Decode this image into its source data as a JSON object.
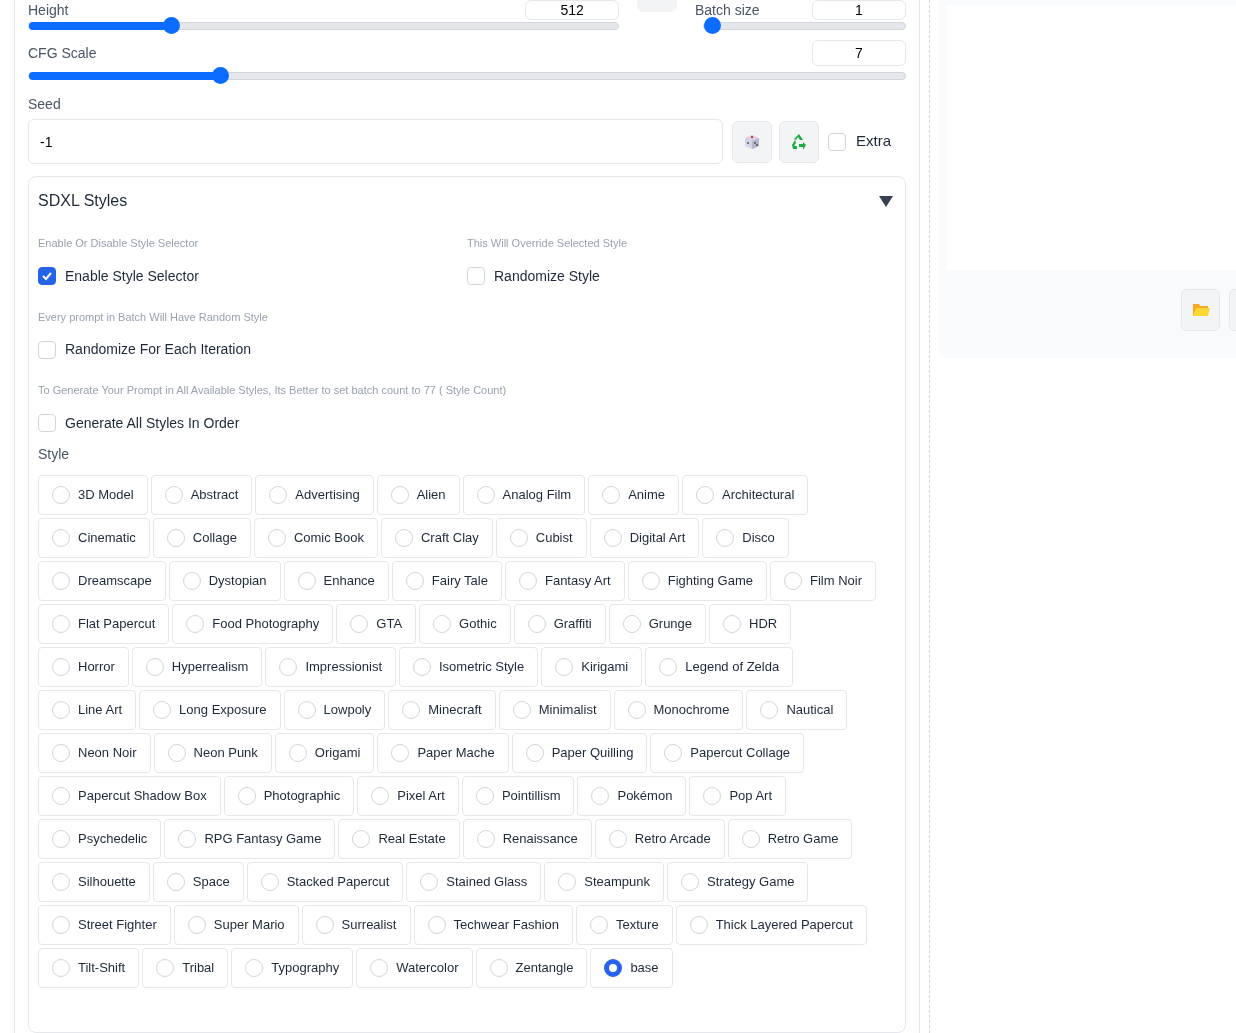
{
  "sliders": [
    {
      "label": "Height",
      "value": "512",
      "level": 0.234
    },
    {
      "label": "Batch size",
      "value": "1",
      "level": 0
    },
    {
      "label": "CFG Scale",
      "value": "7",
      "level": 0.213
    }
  ],
  "seed": {
    "label": "Seed",
    "value": "-1",
    "extra": {
      "label": "Extra",
      "checked": false
    }
  },
  "sdxl_styles": {
    "title": "SDXL Styles",
    "expanded": true,
    "options": [
      {
        "hint": "Enable Or Disable Style Selector",
        "label": "Enable Style Selector",
        "checked": true
      },
      {
        "hint": "This Will Override Selected Style",
        "label": "Randomize Style",
        "checked": false
      },
      {
        "hint": "Every prompt in Batch Will Have Random Style",
        "label": "Randomize For Each Iteration",
        "checked": false
      },
      {
        "hint": "To Generate Your Prompt in All Available Styles, Its Better to set batch count to 77 ( Style Count)",
        "label": "Generate All Styles In Order",
        "checked": false
      }
    ],
    "style_label": "Style",
    "styles": [
      {
        "label": "3D Model",
        "selected": false
      },
      {
        "label": "Abstract",
        "selected": false
      },
      {
        "label": "Advertising",
        "selected": false
      },
      {
        "label": "Alien",
        "selected": false
      },
      {
        "label": "Analog Film",
        "selected": false
      },
      {
        "label": "Anime",
        "selected": false
      },
      {
        "label": "Architectural",
        "selected": false
      },
      {
        "label": "Cinematic",
        "selected": false
      },
      {
        "label": "Collage",
        "selected": false
      },
      {
        "label": "Comic Book",
        "selected": false
      },
      {
        "label": "Craft Clay",
        "selected": false
      },
      {
        "label": "Cubist",
        "selected": false
      },
      {
        "label": "Digital Art",
        "selected": false
      },
      {
        "label": "Disco",
        "selected": false
      },
      {
        "label": "Dreamscape",
        "selected": false
      },
      {
        "label": "Dystopian",
        "selected": false
      },
      {
        "label": "Enhance",
        "selected": false
      },
      {
        "label": "Fairy Tale",
        "selected": false
      },
      {
        "label": "Fantasy Art",
        "selected": false
      },
      {
        "label": "Fighting Game",
        "selected": false
      },
      {
        "label": "Film Noir",
        "selected": false
      },
      {
        "label": "Flat Papercut",
        "selected": false
      },
      {
        "label": "Food Photography",
        "selected": false
      },
      {
        "label": "GTA",
        "selected": false
      },
      {
        "label": "Gothic",
        "selected": false
      },
      {
        "label": "Graffiti",
        "selected": false
      },
      {
        "label": "Grunge",
        "selected": false
      },
      {
        "label": "HDR",
        "selected": false
      },
      {
        "label": "Horror",
        "selected": false
      },
      {
        "label": "Hyperrealism",
        "selected": false
      },
      {
        "label": "Impressionist",
        "selected": false
      },
      {
        "label": "Isometric Style",
        "selected": false
      },
      {
        "label": "Kirigami",
        "selected": false
      },
      {
        "label": "Legend of Zelda",
        "selected": false
      },
      {
        "label": "Line Art",
        "selected": false
      },
      {
        "label": "Long Exposure",
        "selected": false
      },
      {
        "label": "Lowpoly",
        "selected": false
      },
      {
        "label": "Minecraft",
        "selected": false
      },
      {
        "label": "Minimalist",
        "selected": false
      },
      {
        "label": "Monochrome",
        "selected": false
      },
      {
        "label": "Nautical",
        "selected": false
      },
      {
        "label": "Neon Noir",
        "selected": false
      },
      {
        "label": "Neon Punk",
        "selected": false
      },
      {
        "label": "Origami",
        "selected": false
      },
      {
        "label": "Paper Mache",
        "selected": false
      },
      {
        "label": "Paper Quilling",
        "selected": false
      },
      {
        "label": "Papercut Collage",
        "selected": false
      },
      {
        "label": "Papercut Shadow Box",
        "selected": false
      },
      {
        "label": "Photographic",
        "selected": false
      },
      {
        "label": "Pixel Art",
        "selected": false
      },
      {
        "label": "Pointillism",
        "selected": false
      },
      {
        "label": "Pokémon",
        "selected": false
      },
      {
        "label": "Pop Art",
        "selected": false
      },
      {
        "label": "Psychedelic",
        "selected": false
      },
      {
        "label": "RPG Fantasy Game",
        "selected": false
      },
      {
        "label": "Real Estate",
        "selected": false
      },
      {
        "label": "Renaissance",
        "selected": false
      },
      {
        "label": "Retro Arcade",
        "selected": false
      },
      {
        "label": "Retro Game",
        "selected": false
      },
      {
        "label": "Silhouette",
        "selected": false
      },
      {
        "label": "Space",
        "selected": false
      },
      {
        "label": "Stacked Papercut",
        "selected": false
      },
      {
        "label": "Stained Glass",
        "selected": false
      },
      {
        "label": "Steampunk",
        "selected": false
      },
      {
        "label": "Strategy Game",
        "selected": false
      },
      {
        "label": "Street Fighter",
        "selected": false
      },
      {
        "label": "Super Mario",
        "selected": false
      },
      {
        "label": "Surrealist",
        "selected": false
      },
      {
        "label": "Techwear Fashion",
        "selected": false
      },
      {
        "label": "Texture",
        "selected": false
      },
      {
        "label": "Thick Layered Papercut",
        "selected": false
      },
      {
        "label": "Tilt-Shift",
        "selected": false
      },
      {
        "label": "Tribal",
        "selected": false
      },
      {
        "label": "Typography",
        "selected": false
      },
      {
        "label": "Watercolor",
        "selected": false
      },
      {
        "label": "Zentangle",
        "selected": false
      },
      {
        "label": "base",
        "selected": true
      }
    ]
  }
}
